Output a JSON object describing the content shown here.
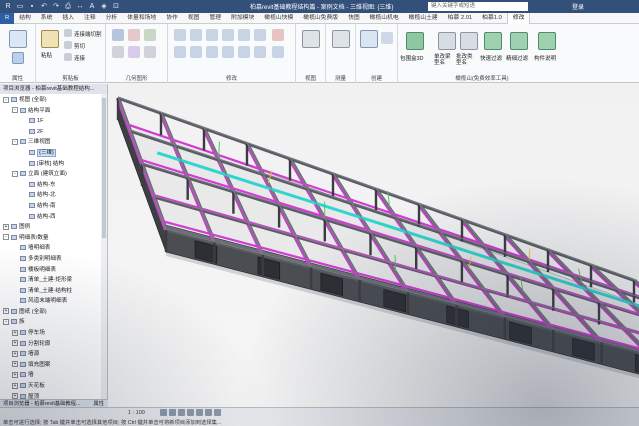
{
  "titlebar": {
    "title": "柏慕revit基础教程结构篇 - 案例文档 - 三维视图: {三维}",
    "search_placeholder": "键入关键字或短语",
    "login": "登录"
  },
  "tabs": [
    "R",
    "结构",
    "系统",
    "插入",
    "注释",
    "分析",
    "体量和场地",
    "协作",
    "视图",
    "管理",
    "附加模块",
    "橄榄山快模",
    "橄榄山免费版",
    "快图",
    "橄榄山机电",
    "橄榄山土建",
    "柏慕 2.01",
    "柏慕1.0",
    "修改"
  ],
  "active_tab": "修改",
  "ribbon": {
    "groups": [
      {
        "label": "属性"
      },
      {
        "label": "剪贴板"
      },
      {
        "label": "几何图形"
      },
      {
        "label": "修改"
      },
      {
        "label": "视图"
      },
      {
        "label": "测量"
      },
      {
        "label": "创建"
      },
      {
        "label": "橄榄山(免费效率工具)"
      }
    ],
    "buttons": {
      "paste": "粘贴",
      "cut": "剪切",
      "join": "连接",
      "clipboard_match": "连接端切割",
      "bim3d": "包围盒3D",
      "single_beam": "单改梁型名",
      "batch_beam": "批改类型名",
      "quick_filter": "快速过滤",
      "fine_filter": "精细过滤",
      "component_info": "构件说明"
    }
  },
  "browser": {
    "title": "项目浏览器 - 柏慕revit基础教程结构...",
    "items": [
      {
        "label": "视图 (全部)",
        "level": 0,
        "expander": "-"
      },
      {
        "label": "结构平面",
        "level": 1,
        "expander": "-"
      },
      {
        "label": "1F",
        "level": 2,
        "expander": ""
      },
      {
        "label": "2F",
        "level": 2,
        "expander": ""
      },
      {
        "label": "三维视图",
        "level": 1,
        "expander": "-"
      },
      {
        "label": "{三维}",
        "level": 2,
        "expander": "",
        "selected": true
      },
      {
        "label": "[审核] 结构",
        "level": 2,
        "expander": ""
      },
      {
        "label": "立面 (建筑立面)",
        "level": 1,
        "expander": "-"
      },
      {
        "label": "结构-东",
        "level": 2,
        "expander": ""
      },
      {
        "label": "结构-北",
        "level": 2,
        "expander": ""
      },
      {
        "label": "结构-南",
        "level": 2,
        "expander": ""
      },
      {
        "label": "结构-西",
        "level": 2,
        "expander": ""
      },
      {
        "label": "图例",
        "level": 0,
        "expander": "+"
      },
      {
        "label": "明细表/数量",
        "level": 0,
        "expander": "-"
      },
      {
        "label": "墙明细表",
        "level": 1,
        "expander": ""
      },
      {
        "label": "多类别明细表",
        "level": 1,
        "expander": ""
      },
      {
        "label": "楼板明细表",
        "level": 1,
        "expander": ""
      },
      {
        "label": "清单_土建-矩形梁",
        "level": 1,
        "expander": ""
      },
      {
        "label": "清单_土建-结构柱",
        "level": 1,
        "expander": ""
      },
      {
        "label": "风道末端明细表",
        "level": 1,
        "expander": ""
      },
      {
        "label": "图纸 (全部)",
        "level": 0,
        "expander": "+"
      },
      {
        "label": "族",
        "level": 0,
        "expander": "-"
      },
      {
        "label": "停车场",
        "level": 1,
        "expander": "+"
      },
      {
        "label": "分割轮廓",
        "level": 1,
        "expander": "+"
      },
      {
        "label": "墙源",
        "level": 1,
        "expander": "+"
      },
      {
        "label": "填充图案",
        "level": 1,
        "expander": "+"
      },
      {
        "label": "墙",
        "level": 1,
        "expander": "+"
      },
      {
        "label": "天花板",
        "level": 1,
        "expander": "+"
      },
      {
        "label": "屋顶",
        "level": 1,
        "expander": "+"
      }
    ]
  },
  "bottom_tab": "项目浏览器 - 柏慕revit基础教程...",
  "bottom_tab_right": "属性",
  "status": {
    "scale": "1 : 100",
    "hint": "单击可进行选择; 按 Tab 键并单击可选择其他项目; 按 Ctrl 键并单击可将新项目添加到选择集..."
  },
  "colors": {
    "title_bar": "#33507a",
    "beam_magenta": "#d23bd6",
    "beam_cyan": "#2fd6d0",
    "structure_dark": "#4a4d52"
  }
}
